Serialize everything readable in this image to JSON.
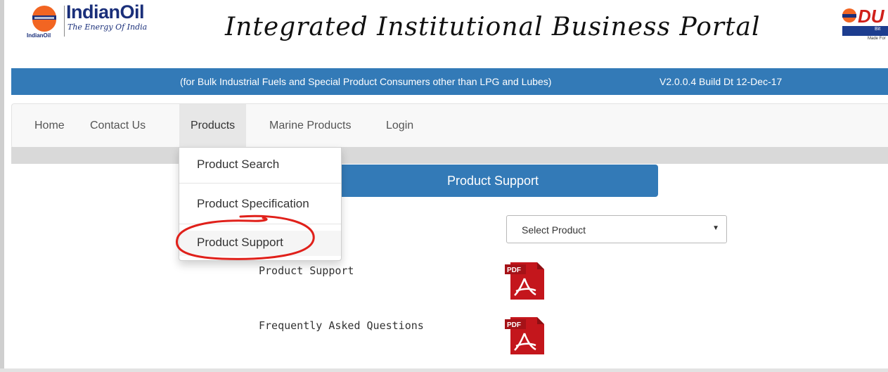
{
  "header": {
    "brand_name": "IndianOil",
    "brand_tagline": "The Energy Of India",
    "brand_small": "IndianOil",
    "portal_title": "Integrated Institutional Business Portal",
    "right_logo_text": "DU",
    "right_logo_sub": "Bit",
    "right_logo_made": "Made For"
  },
  "subtitle_bar": {
    "text": "(for Bulk Industrial Fuels and Special Product Consumers other than LPG and Lubes)",
    "version": "V2.0.0.4 Build Dt 12-Dec-17"
  },
  "nav": {
    "items": [
      {
        "label": "Home"
      },
      {
        "label": "Contact Us"
      },
      {
        "label": "Products"
      },
      {
        "label": "Marine Products"
      },
      {
        "label": "Login"
      }
    ]
  },
  "dropdown": {
    "items": [
      {
        "label": "Product Search"
      },
      {
        "label": "Product Specification"
      },
      {
        "label": "Product Support"
      }
    ]
  },
  "content": {
    "header": "Product Support",
    "select": {
      "selected": "Select Product"
    },
    "rows": [
      {
        "label": "Product Support",
        "icon_text": "PDF"
      },
      {
        "label": "Frequently Asked Questions",
        "icon_text": "PDF"
      }
    ]
  },
  "colors": {
    "primary_blue": "#337ab7",
    "brand_blue": "#1a2f7a",
    "pdf_red": "#c4161c",
    "annotation_red": "#e0201a"
  }
}
